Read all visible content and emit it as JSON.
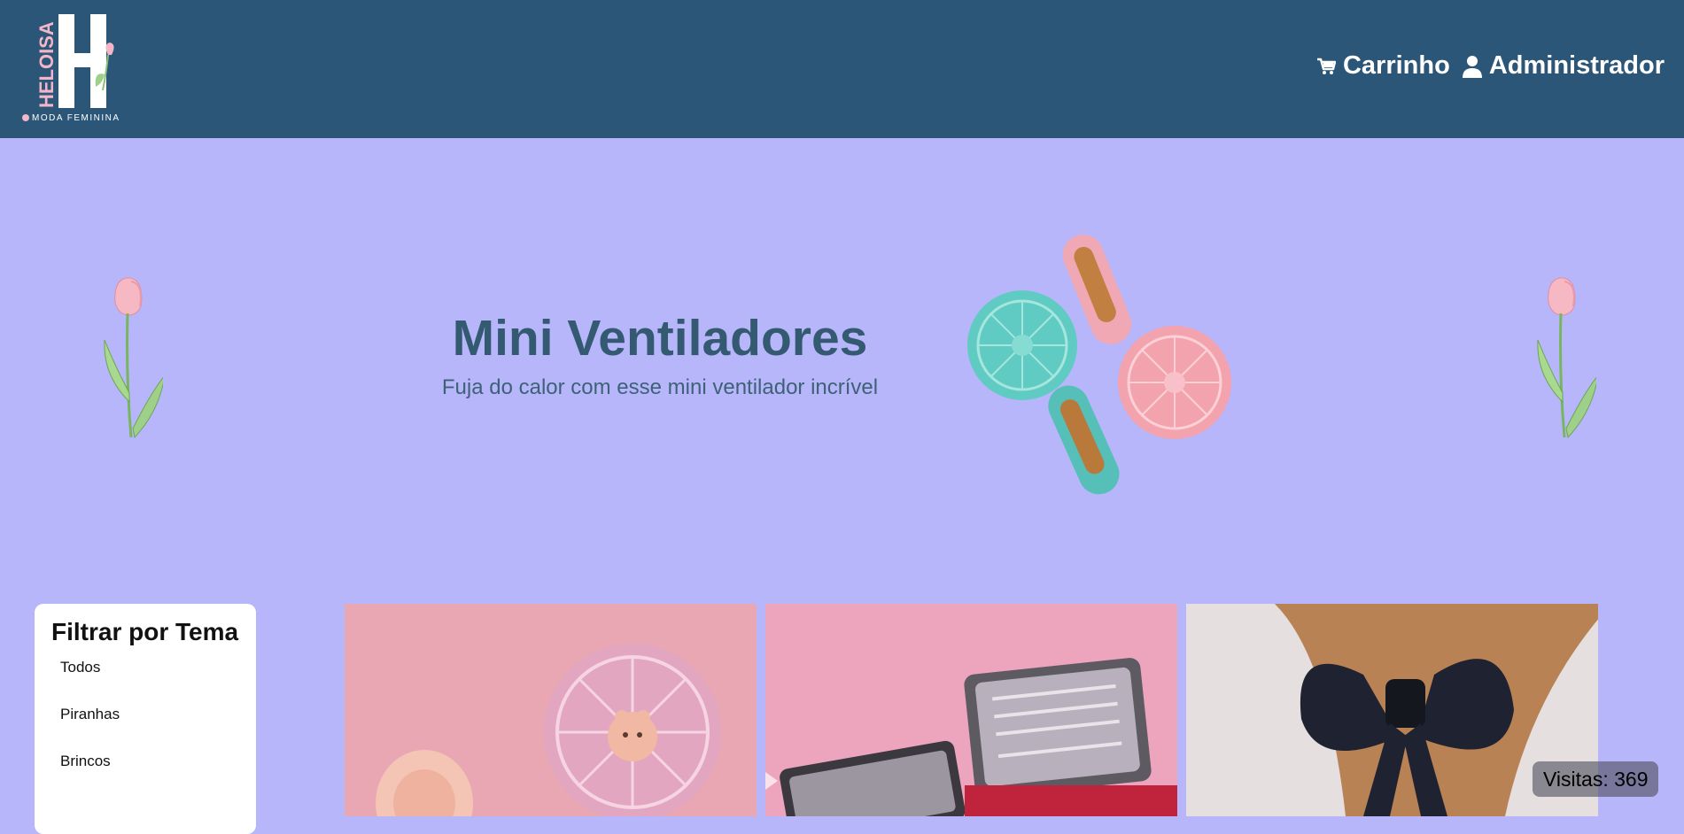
{
  "brand": {
    "name": "HELOISA",
    "letter": "H",
    "tagline": "MODA FEMININA"
  },
  "nav": {
    "cart_label": "Carrinho",
    "cart_icon": "cart-icon",
    "admin_label": "Administrador",
    "admin_icon": "user-icon"
  },
  "hero": {
    "title": "Mini Ventiladores",
    "subtitle": "Fuja do calor com esse mini ventilador incrível"
  },
  "filter": {
    "title": "Filtrar por Tema",
    "items": [
      "Todos",
      "Piranhas",
      "Brincos"
    ]
  },
  "visits": {
    "label": "Visitas: 369"
  },
  "colors": {
    "header": "#2b5677",
    "background": "#b7b6fb",
    "hero_title": "#345a72"
  }
}
